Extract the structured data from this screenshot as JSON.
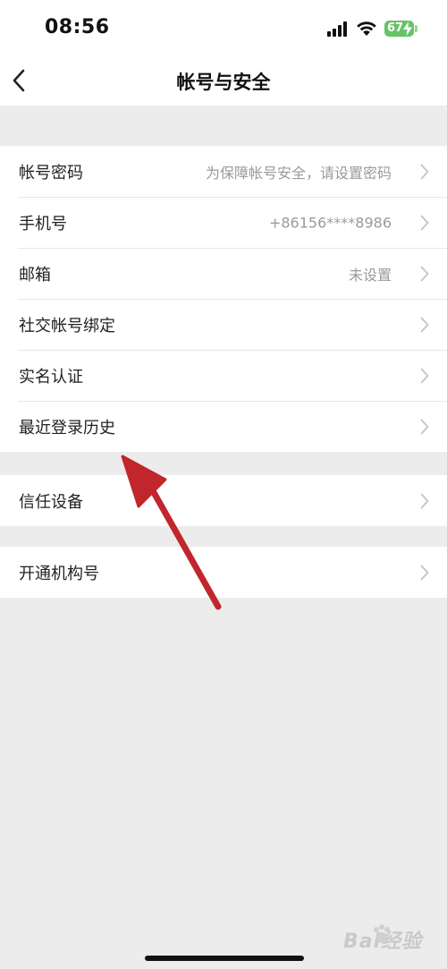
{
  "status_bar": {
    "time": "08:56",
    "battery": "67"
  },
  "nav": {
    "title": "帐号与安全"
  },
  "groups": [
    {
      "items": [
        {
          "label": "帐号密码",
          "value": "为保障帐号安全，请设置密码"
        },
        {
          "label": "手机号",
          "value": "+86156****8986"
        },
        {
          "label": "邮箱",
          "value": "未设置"
        },
        {
          "label": "社交帐号绑定",
          "value": ""
        },
        {
          "label": "实名认证",
          "value": ""
        },
        {
          "label": "最近登录历史",
          "value": ""
        }
      ]
    },
    {
      "items": [
        {
          "label": "信任设备",
          "value": ""
        }
      ]
    },
    {
      "items": [
        {
          "label": "开通机构号",
          "value": ""
        }
      ]
    }
  ],
  "watermark": {
    "text": "Bai经验"
  },
  "colors": {
    "background": "#ececec",
    "row_background": "#ffffff",
    "secondary_text": "#9a9a9a",
    "annotation_arrow": "#c0262b",
    "battery": "#65c466"
  }
}
